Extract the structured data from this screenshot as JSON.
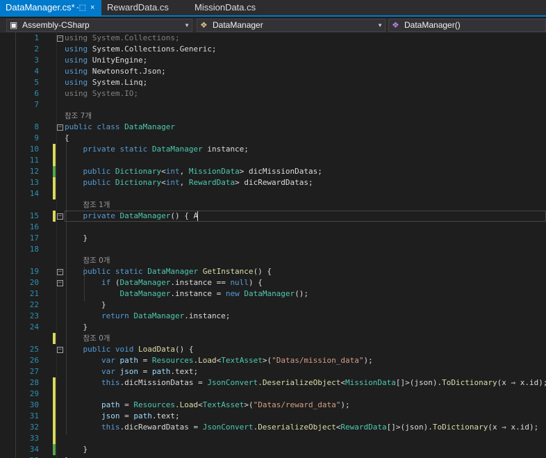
{
  "tabs": [
    {
      "label": "DataManager.cs*",
      "active": true,
      "pin": "-⬚",
      "close": "×"
    },
    {
      "label": "RewardData.cs",
      "active": false
    },
    {
      "label": "MissionData.cs",
      "active": false
    }
  ],
  "nav": {
    "project": "Assembly-CSharp",
    "class": "DataManager",
    "member": "DataManager()"
  },
  "lines": [
    {
      "n": 1,
      "fold": "−",
      "chg": "",
      "tokens": [
        [
          "u",
          "using "
        ],
        [
          "u",
          "System.Collections;"
        ]
      ]
    },
    {
      "n": 2,
      "chg": "",
      "tokens": [
        [
          "k",
          "using "
        ],
        [
          "",
          "System.Collections.Generic;"
        ]
      ]
    },
    {
      "n": 3,
      "chg": "",
      "tokens": [
        [
          "k",
          "using "
        ],
        [
          "",
          "UnityEngine;"
        ]
      ]
    },
    {
      "n": 4,
      "chg": "",
      "tokens": [
        [
          "k",
          "using "
        ],
        [
          "",
          "Newtonsoft.Json;"
        ]
      ]
    },
    {
      "n": 5,
      "chg": "",
      "tokens": [
        [
          "k",
          "using "
        ],
        [
          "",
          "System.Linq;"
        ]
      ]
    },
    {
      "n": 6,
      "chg": "",
      "tokens": [
        [
          "u",
          "using "
        ],
        [
          "u",
          "System.IO;"
        ]
      ]
    },
    {
      "n": 7,
      "chg": "",
      "tokens": []
    },
    {
      "ref": "참조 7개",
      "indent": 0
    },
    {
      "n": 8,
      "fold": "−",
      "chg": "",
      "tokens": [
        [
          "k",
          "public "
        ],
        [
          "k",
          "class "
        ],
        [
          "t",
          "DataManager"
        ]
      ]
    },
    {
      "n": 9,
      "chg": "",
      "tokens": [
        [
          "",
          "{"
        ]
      ]
    },
    {
      "n": 10,
      "chg": "y",
      "tokens": [
        [
          "",
          "    "
        ],
        [
          "k",
          "private "
        ],
        [
          "k",
          "static "
        ],
        [
          "t",
          "DataManager"
        ],
        [
          "",
          " instance;"
        ]
      ]
    },
    {
      "n": 11,
      "chg": "y",
      "tokens": []
    },
    {
      "n": 12,
      "chg": "g",
      "tokens": [
        [
          "",
          "    "
        ],
        [
          "k",
          "public "
        ],
        [
          "t",
          "Dictionary"
        ],
        [
          "",
          "<"
        ],
        [
          "k",
          "int"
        ],
        [
          ", "
        ],
        [
          "t",
          "MissionData"
        ],
        [
          "",
          "> dicMissionDatas;"
        ]
      ]
    },
    {
      "n": 13,
      "chg": "y",
      "tokens": [
        [
          "",
          "    "
        ],
        [
          "k",
          "public "
        ],
        [
          "t",
          "Dictionary"
        ],
        [
          "",
          "<"
        ],
        [
          "k",
          "int"
        ],
        [
          ", "
        ],
        [
          "t",
          "RewardData"
        ],
        [
          "",
          "> dicRewardDatas;"
        ]
      ]
    },
    {
      "n": 14,
      "chg": "y",
      "tokens": []
    },
    {
      "ref": "참조 1개",
      "indent": 4
    },
    {
      "n": 15,
      "fold": "−",
      "chg": "y",
      "cur": true,
      "tokens": [
        [
          "",
          "    "
        ],
        [
          "k",
          "private "
        ],
        [
          "t",
          "DataManager"
        ],
        [
          "",
          "() { A"
        ]
      ]
    },
    {
      "n": 16,
      "chg": "",
      "tokens": []
    },
    {
      "n": 17,
      "chg": "",
      "tokens": [
        [
          "",
          "    }"
        ]
      ]
    },
    {
      "n": 18,
      "chg": "",
      "tokens": []
    },
    {
      "ref": "참조 0개",
      "indent": 4
    },
    {
      "n": 19,
      "fold": "−",
      "chg": "",
      "tokens": [
        [
          "",
          "    "
        ],
        [
          "k",
          "public "
        ],
        [
          "k",
          "static "
        ],
        [
          "t",
          "DataManager"
        ],
        [
          " "
        ],
        [
          "m",
          "GetInstance"
        ],
        [
          "",
          "() {"
        ]
      ]
    },
    {
      "n": 20,
      "fold": "−",
      "chg": "",
      "tokens": [
        [
          "",
          "        "
        ],
        [
          "k",
          "if "
        ],
        [
          "",
          "("
        ],
        [
          "t",
          "DataManager"
        ],
        [
          "",
          ".instance == "
        ],
        [
          "k",
          "null"
        ],
        [
          ") {"
        ]
      ]
    },
    {
      "n": 21,
      "chg": "",
      "tokens": [
        [
          "",
          "            "
        ],
        [
          "t",
          "DataManager"
        ],
        [
          "",
          ".instance = "
        ],
        [
          "k",
          "new "
        ],
        [
          "t",
          "DataManager"
        ],
        [
          "",
          "();"
        ]
      ]
    },
    {
      "n": 22,
      "chg": "",
      "tokens": [
        [
          "",
          "        }"
        ]
      ]
    },
    {
      "n": 23,
      "chg": "",
      "tokens": [
        [
          "",
          "        "
        ],
        [
          "k",
          "return "
        ],
        [
          "t",
          "DataManager"
        ],
        [
          "",
          ".instance;"
        ]
      ]
    },
    {
      "n": 24,
      "chg": "",
      "tokens": [
        [
          "",
          "    }"
        ]
      ]
    },
    {
      "ref": "참조 0개",
      "indent": 4,
      "chg": "y"
    },
    {
      "n": 25,
      "fold": "−",
      "chg": "",
      "tokens": [
        [
          "",
          "    "
        ],
        [
          "k",
          "public "
        ],
        [
          "k",
          "void "
        ],
        [
          "m",
          "LoadData"
        ],
        [
          "",
          "() {"
        ]
      ]
    },
    {
      "n": 26,
      "chg": "",
      "tokens": [
        [
          "",
          "        "
        ],
        [
          "k",
          "var "
        ],
        [
          "p",
          "path"
        ],
        [
          "",
          " = "
        ],
        [
          "t",
          "Resources"
        ],
        [
          "",
          "."
        ],
        [
          "m",
          "Load"
        ],
        [
          "",
          "<"
        ],
        [
          "t",
          "TextAsset"
        ],
        [
          "",
          ">("
        ],
        [
          "s",
          "\"Datas/mission_data\""
        ],
        [
          "",
          ");"
        ]
      ]
    },
    {
      "n": 27,
      "chg": "",
      "tokens": [
        [
          "",
          "        "
        ],
        [
          "k",
          "var "
        ],
        [
          "p",
          "json"
        ],
        [
          "",
          " = "
        ],
        [
          "p",
          "path"
        ],
        [
          "",
          ".text;"
        ]
      ]
    },
    {
      "n": 28,
      "chg": "y",
      "tokens": [
        [
          "",
          "        "
        ],
        [
          "k",
          "this"
        ],
        [
          "",
          ".dicMissionDatas = "
        ],
        [
          "t",
          "JsonConvert"
        ],
        [
          "",
          "."
        ],
        [
          "m",
          "DeserializeObject"
        ],
        [
          "",
          "<"
        ],
        [
          "t",
          "MissionData"
        ],
        [
          "",
          "[]>(json)."
        ],
        [
          "m",
          "ToDictionary"
        ],
        [
          "",
          "(x ⇒ x.id);"
        ]
      ]
    },
    {
      "n": 29,
      "chg": "y",
      "tokens": []
    },
    {
      "n": 30,
      "chg": "y",
      "tokens": [
        [
          "",
          "        "
        ],
        [
          "p",
          "path"
        ],
        [
          "",
          " = "
        ],
        [
          "t",
          "Resources"
        ],
        [
          "",
          "."
        ],
        [
          "m",
          "Load"
        ],
        [
          "",
          "<"
        ],
        [
          "t",
          "TextAsset"
        ],
        [
          "",
          ">("
        ],
        [
          "s",
          "\"Datas/reward_data\""
        ],
        [
          "",
          ");"
        ]
      ]
    },
    {
      "n": 31,
      "chg": "y",
      "tokens": [
        [
          "",
          "        "
        ],
        [
          "p",
          "json"
        ],
        [
          "",
          " = "
        ],
        [
          "p",
          "path"
        ],
        [
          "",
          ".text;"
        ]
      ]
    },
    {
      "n": 32,
      "chg": "y",
      "tokens": [
        [
          "",
          "        "
        ],
        [
          "k",
          "this"
        ],
        [
          "",
          ".dicRewardDatas = "
        ],
        [
          "t",
          "JsonConvert"
        ],
        [
          "",
          "."
        ],
        [
          "m",
          "DeserializeObject"
        ],
        [
          "",
          "<"
        ],
        [
          "t",
          "RewardData"
        ],
        [
          "",
          "[]>(json)."
        ],
        [
          "m",
          "ToDictionary"
        ],
        [
          "",
          "(x ⇒ x.id);"
        ]
      ]
    },
    {
      "n": 33,
      "chg": "y",
      "tokens": []
    },
    {
      "n": 34,
      "chg": "g",
      "tokens": [
        [
          "",
          "    }"
        ]
      ]
    },
    {
      "n": 35,
      "chg": "",
      "tokens": [
        [
          "",
          "}"
        ]
      ]
    }
  ],
  "colors": {
    "accent": "#007acc",
    "change_saved": "#57a64a",
    "change_unsaved": "#d9d95b"
  },
  "icons": {
    "project": "cs-project-icon",
    "class": "class-icon",
    "member": "method-icon"
  }
}
